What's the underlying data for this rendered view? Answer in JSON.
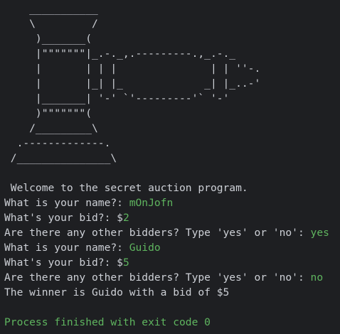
{
  "colors": {
    "background": "#1e1f22",
    "text": "#cdd0d6",
    "user_input": "#5fb55f",
    "process_exit": "#5fb55f"
  },
  "ascii_art": [
    "    ___________",
    "    \\         /",
    "     )_______(",
    "     |\"\"\"\"\"\"\"|_.-._,.---------.,_.-._",
    "     |       | | |               | | ''-.",
    "     |       |_| |_             _| |_..-'",
    "     |_______| '-' `'---------'` '-'",
    "     )\"\"\"\"\"\"\"(",
    "    /_________\\",
    "  .-------------.",
    " /_______________\\"
  ],
  "welcome": " Welcome to the secret auction program.",
  "prompt_name": "What is your name?: ",
  "prompt_bid": "What's your bid?: $",
  "prompt_others": "Are there any other bidders? Type 'yes' or 'no': ",
  "entry1": {
    "name": "mOnJofn",
    "bid": "2",
    "more": "yes"
  },
  "entry2": {
    "name": "Guido",
    "bid": "5",
    "more": "no"
  },
  "result": "The winner is Guido with a bid of $5",
  "exit_message": "Process finished with exit code 0"
}
